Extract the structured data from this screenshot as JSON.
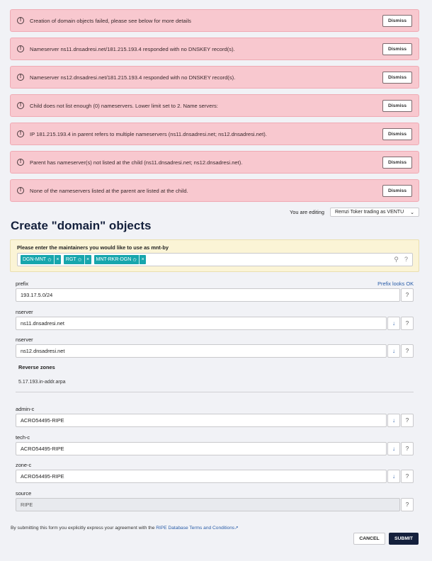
{
  "alerts": [
    {
      "message": "Creation of domain objects failed, please see below for more details",
      "dismiss": "Dismiss"
    },
    {
      "message": "Nameserver ns11.dnsadresi.net/181.215.193.4 responded with no DNSKEY record(s).",
      "dismiss": "Dismiss"
    },
    {
      "message": "Nameserver ns12.dnsadresi.net/181.215.193.4 responded with no DNSKEY record(s).",
      "dismiss": "Dismiss"
    },
    {
      "message": "Child does not list enough (0) nameservers. Lower limit set to 2. Name servers:",
      "dismiss": "Dismiss"
    },
    {
      "message": "IP 181.215.193.4 in parent refers to multiple nameservers (ns11.dnsadresi.net; ns12.dnsadresi.net).",
      "dismiss": "Dismiss"
    },
    {
      "message": "Parent has nameserver(s) not listed at the child (ns11.dnsadresi.net; ns12.dnsadresi.net).",
      "dismiss": "Dismiss"
    },
    {
      "message": "None of the nameservers listed at the parent are listed at the child.",
      "dismiss": "Dismiss"
    }
  ],
  "editing": {
    "label": "You are editing",
    "value": "Remzi Toker trading as VENTU",
    "caret": "⌄"
  },
  "page_title": "Create \"domain\" objects",
  "maintainers": {
    "header": "Please enter the maintainers you would like to use as mnt-by",
    "tags": [
      "DGN-MNT",
      "RGT",
      "MNT-RKR-DGN"
    ],
    "star_icon": "✩",
    "remove_icon": "×"
  },
  "fields": {
    "prefix": {
      "label": "prefix",
      "value": "193.17.5.0/24",
      "status": "Prefix looks OK"
    },
    "nserver1": {
      "label": "nserver",
      "value": "ns11.dnsadresi.net"
    },
    "nserver2": {
      "label": "nserver",
      "value": "ns12.dnsadresi.net"
    },
    "admin_c": {
      "label": "admin-c",
      "value": "ACRO54495-RIPE"
    },
    "tech_c": {
      "label": "tech-c",
      "value": "ACRO54495-RIPE"
    },
    "zone_c": {
      "label": "zone-c",
      "value": "ACRO54495-RIPE"
    },
    "source": {
      "label": "source",
      "value": "RIPE"
    }
  },
  "reverse_zones": {
    "heading": "Reverse zones",
    "value": "5.17.193.in-addr.arpa"
  },
  "icons": {
    "alert": "!",
    "arrow": "↓",
    "help": "?",
    "search": "⚲"
  },
  "terms": {
    "text": "By submitting this form you explicitly express your agreement with the ",
    "link": "RIPE Database Terms and Conditions",
    "ext": "↗"
  },
  "buttons": {
    "cancel": "CANCEL",
    "submit": "SUBMIT"
  }
}
